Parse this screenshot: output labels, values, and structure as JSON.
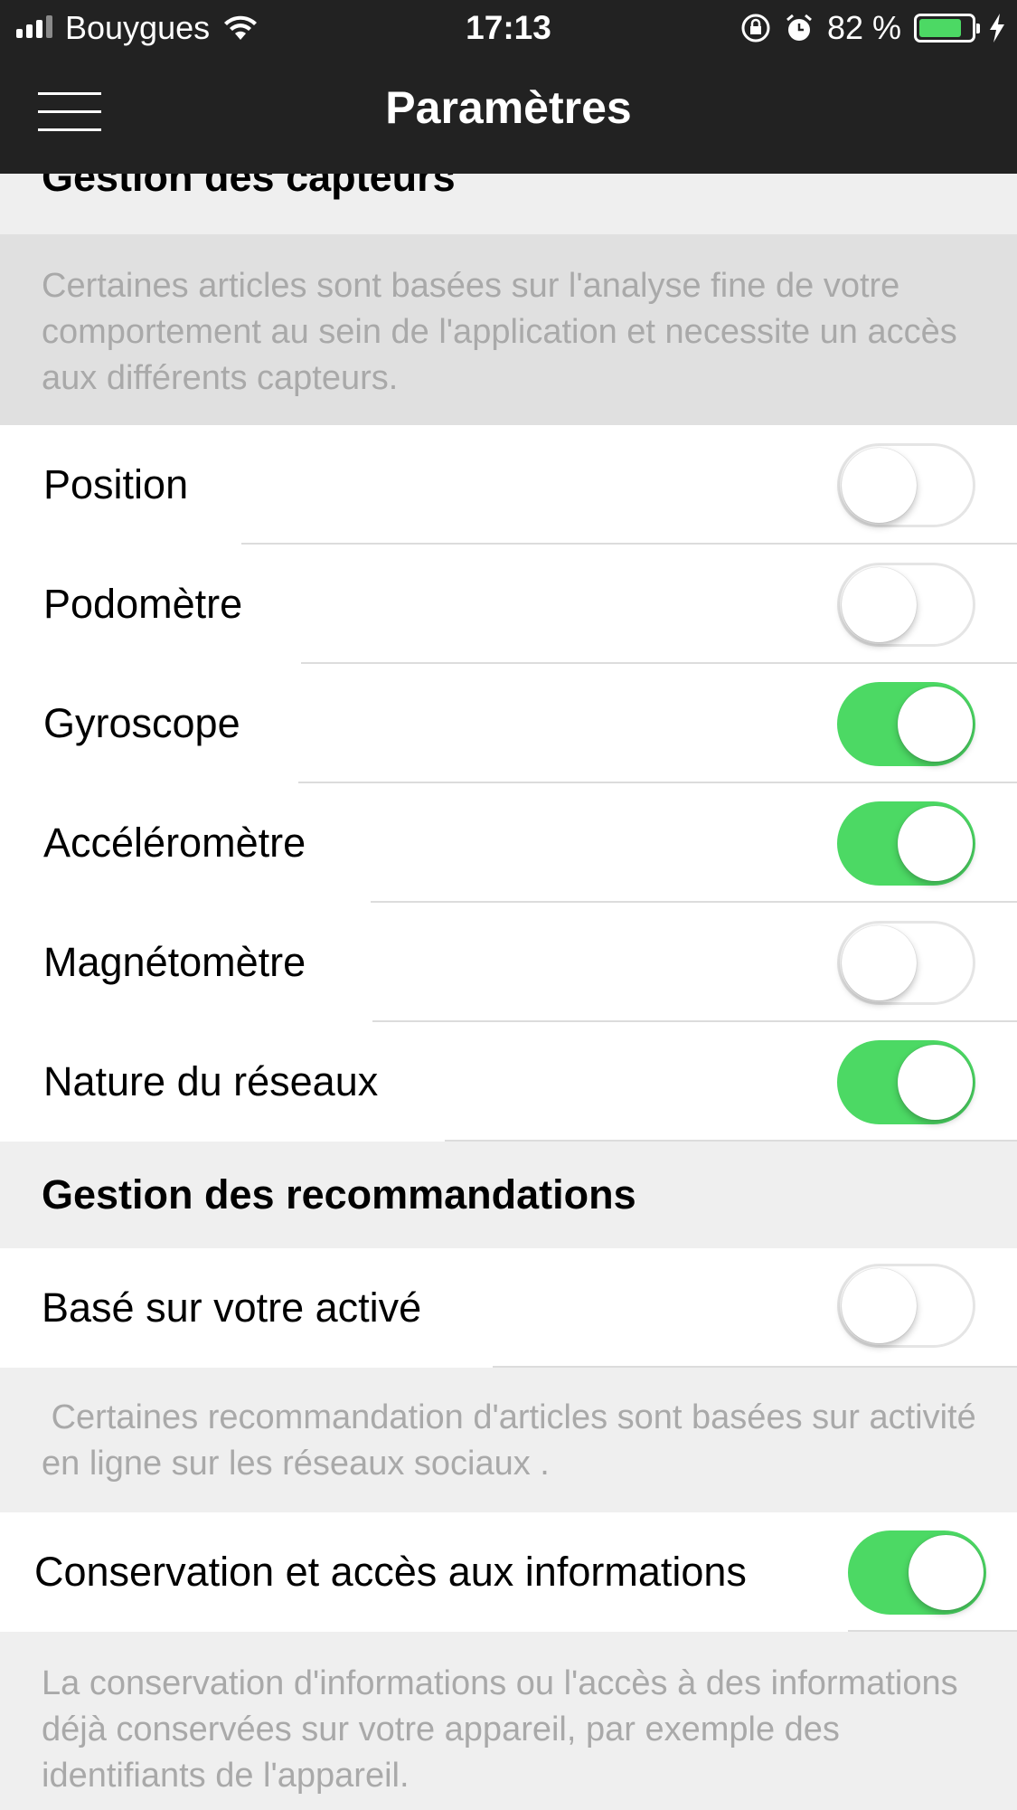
{
  "status_bar": {
    "carrier": "Bouygues",
    "time": "17:13",
    "battery": "82 %",
    "battery_level": 0.82
  },
  "nav": {
    "title": "Paramètres"
  },
  "sections": {
    "capteurs": {
      "title": "Gestion des capteurs",
      "description": "Certaines articles sont basées sur l'analyse fine de votre comportement au sein de l'application et necessite un accès aux différents capteurs.",
      "rows": [
        {
          "label": "Position",
          "on": false
        },
        {
          "label": "Podomètre",
          "on": false
        },
        {
          "label": "Gyroscope",
          "on": true
        },
        {
          "label": "Accéléromètre",
          "on": true
        },
        {
          "label": "Magnétomètre",
          "on": false
        },
        {
          "label": "Nature du réseaux",
          "on": true
        }
      ]
    },
    "recommandations": {
      "title": "Gestion des recommandations",
      "row1": {
        "label": "Basé sur votre activé",
        "on": false
      },
      "description1": " Certaines recommandation d'articles sont basées sur activité en ligne sur les réseaux sociaux .",
      "row2": {
        "label": "Conservation et accès aux informations",
        "on": true
      },
      "description2": "La conservation d'informations ou l'accès à des informations déjà conservées sur votre appareil, par exemple des identifiants de l'appareil."
    }
  },
  "colors": {
    "toggle_on": "#4cd964",
    "bar_background": "#222222",
    "section_background": "#efefef"
  }
}
